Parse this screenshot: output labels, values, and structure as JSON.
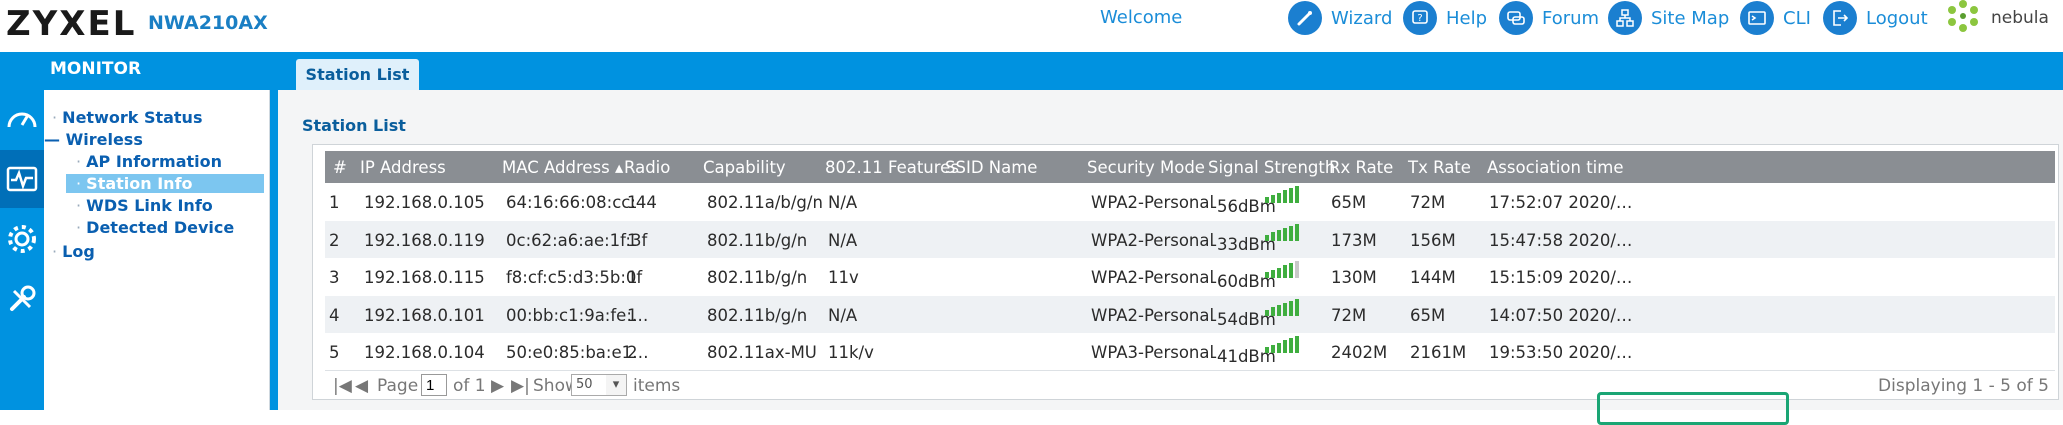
{
  "header": {
    "logo": "ZYXEL",
    "model": "NWA210AX",
    "welcome": "Welcome",
    "toolbar": [
      {
        "label": "Wizard",
        "icon": "wand-icon"
      },
      {
        "label": "Help",
        "icon": "help-icon"
      },
      {
        "label": "Forum",
        "icon": "forum-icon"
      },
      {
        "label": "Site Map",
        "icon": "sitemap-icon"
      },
      {
        "label": "CLI",
        "icon": "cli-icon"
      },
      {
        "label": "Logout",
        "icon": "logout-icon"
      }
    ],
    "nebula": "nebula"
  },
  "topbar": {
    "monitor": "MONITOR",
    "tab": "Station List"
  },
  "nav": {
    "network_status": "Network Status",
    "wireless": "Wireless",
    "ap_information": "AP Information",
    "station_info": "Station Info",
    "wds_link_info": "WDS Link Info",
    "detected_device": "Detected Device",
    "log": "Log"
  },
  "section_title": "Station List",
  "columns": [
    "#",
    "IP Address",
    "MAC Address ▴",
    "Radio",
    "Capability",
    "802.11 Features",
    "SSID Name",
    "Security Mode",
    "Signal Strength",
    "Rx Rate",
    "Tx Rate",
    "Association time"
  ],
  "rows": [
    {
      "n": "1",
      "ip": "192.168.0.105",
      "mac": "64:16:66:08:cc:44",
      "radio": "1",
      "cap": "802.11a/b/g/n",
      "feat": "N/A",
      "ssid": "",
      "sec": "WPA2-Personal",
      "sig": "-56dBm",
      "bars": 5,
      "rx": "65M",
      "tx": "72M",
      "assoc": "17:52:07 2020/…"
    },
    {
      "n": "2",
      "ip": "192.168.0.119",
      "mac": "0c:62:a6:ae:1f:3f",
      "radio": "1",
      "cap": "802.11b/g/n",
      "feat": "N/A",
      "ssid": "",
      "sec": "WPA2-Personal",
      "sig": "-33dBm",
      "bars": 5,
      "rx": "173M",
      "tx": "156M",
      "assoc": "15:47:58 2020/…"
    },
    {
      "n": "3",
      "ip": "192.168.0.115",
      "mac": "f8:cf:c5:d3:5b:0f",
      "radio": "1",
      "cap": "802.11b/g/n",
      "feat": "11v",
      "ssid": "",
      "sec": "WPA2-Personal",
      "sig": "-60dBm",
      "bars": 4,
      "rx": "130M",
      "tx": "144M",
      "assoc": "15:15:09 2020/…"
    },
    {
      "n": "4",
      "ip": "192.168.0.101",
      "mac": "00:bb:c1:9a:fe:…",
      "radio": "1",
      "cap": "802.11b/g/n",
      "feat": "N/A",
      "ssid": "",
      "sec": "WPA2-Personal",
      "sig": "-54dBm",
      "bars": 5,
      "rx": "72M",
      "tx": "65M",
      "assoc": "14:07:50 2020/…"
    },
    {
      "n": "5",
      "ip": "192.168.0.104",
      "mac": "50:e0:85:ba:e1…",
      "radio": "2",
      "cap": "802.11ax-MU",
      "feat": "11k/v",
      "ssid": "",
      "sec": "WPA3-Personal",
      "sig": "-41dBm",
      "bars": 5,
      "rx": "2402M",
      "tx": "2161M",
      "assoc": "19:53:50 2020/…"
    }
  ],
  "pager": {
    "page_label": "Page",
    "page_value": "1",
    "of_label": "of 1",
    "show_label": "Show",
    "show_value": "50",
    "items_label": "items",
    "displaying": "Displaying 1 - 5 of 5"
  },
  "colors": {
    "brand_blue": "#0092e0",
    "link_blue": "#0a5fb0",
    "highlight_green": "#1aa574",
    "signal_green": "#3fae3f"
  }
}
